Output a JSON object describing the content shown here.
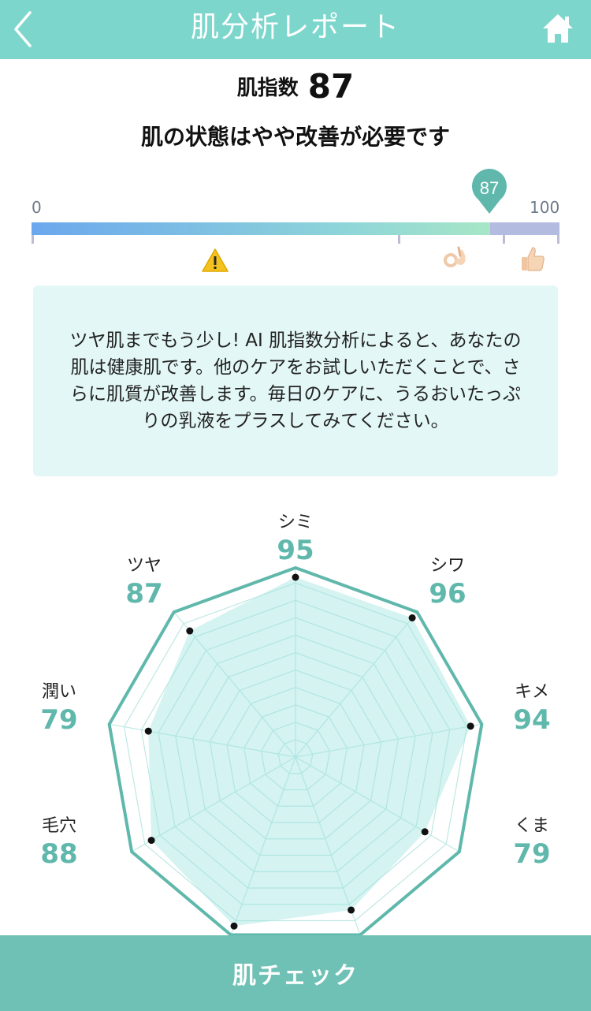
{
  "header": {
    "title": "肌分析レポート",
    "back_icon": "chevron-left-icon",
    "home_icon": "home-icon"
  },
  "summary": {
    "score_label": "肌指数",
    "score_value": "87",
    "headline": "肌の状態はやや改善が必要です"
  },
  "scale": {
    "min_label": "0",
    "max_label": "100",
    "marker_label": "87",
    "value": 87,
    "icons": [
      "warning-icon",
      "ok-hand-icon",
      "thumbs-up-icon"
    ],
    "colors": {
      "start": "#6aa7ee",
      "end": "#a7e6c6",
      "rest": "#b4bbe0",
      "marker": "#5fb8ab"
    }
  },
  "message": "ツヤ肌までもう少し! AI 肌指数分析によると、あなたの肌は健康肌です。他のケアをお試しいただくことで、さらに肌質が改善します。毎日のケアに、うるおいたっぷりの乳液をプラスしてみてください。",
  "chart_data": {
    "type": "radar",
    "max": 100,
    "categories": [
      "シミ",
      "シワ",
      "キメ",
      "くま",
      "",
      "",
      "毛穴",
      "潤い",
      "ツヤ"
    ],
    "values": [
      95,
      96,
      94,
      79,
      86,
      95,
      88,
      79,
      87
    ],
    "series": [
      {
        "values": [
          95,
          96,
          94,
          79,
          86,
          95,
          88,
          79,
          87
        ]
      }
    ],
    "colors": {
      "fill": "#9fe5df",
      "outline": "#5fb8ab",
      "grid": "#bfe8e3"
    }
  },
  "radar_labels": [
    {
      "name": "シミ",
      "value": "95"
    },
    {
      "name": "シワ",
      "value": "96"
    },
    {
      "name": "キメ",
      "value": "94"
    },
    {
      "name": "くま",
      "value": "79"
    },
    {
      "name": "毛穴",
      "value": "88"
    },
    {
      "name": "潤い",
      "value": "79"
    },
    {
      "name": "ツヤ",
      "value": "87"
    }
  ],
  "footer": {
    "button_label": "肌チェック"
  }
}
